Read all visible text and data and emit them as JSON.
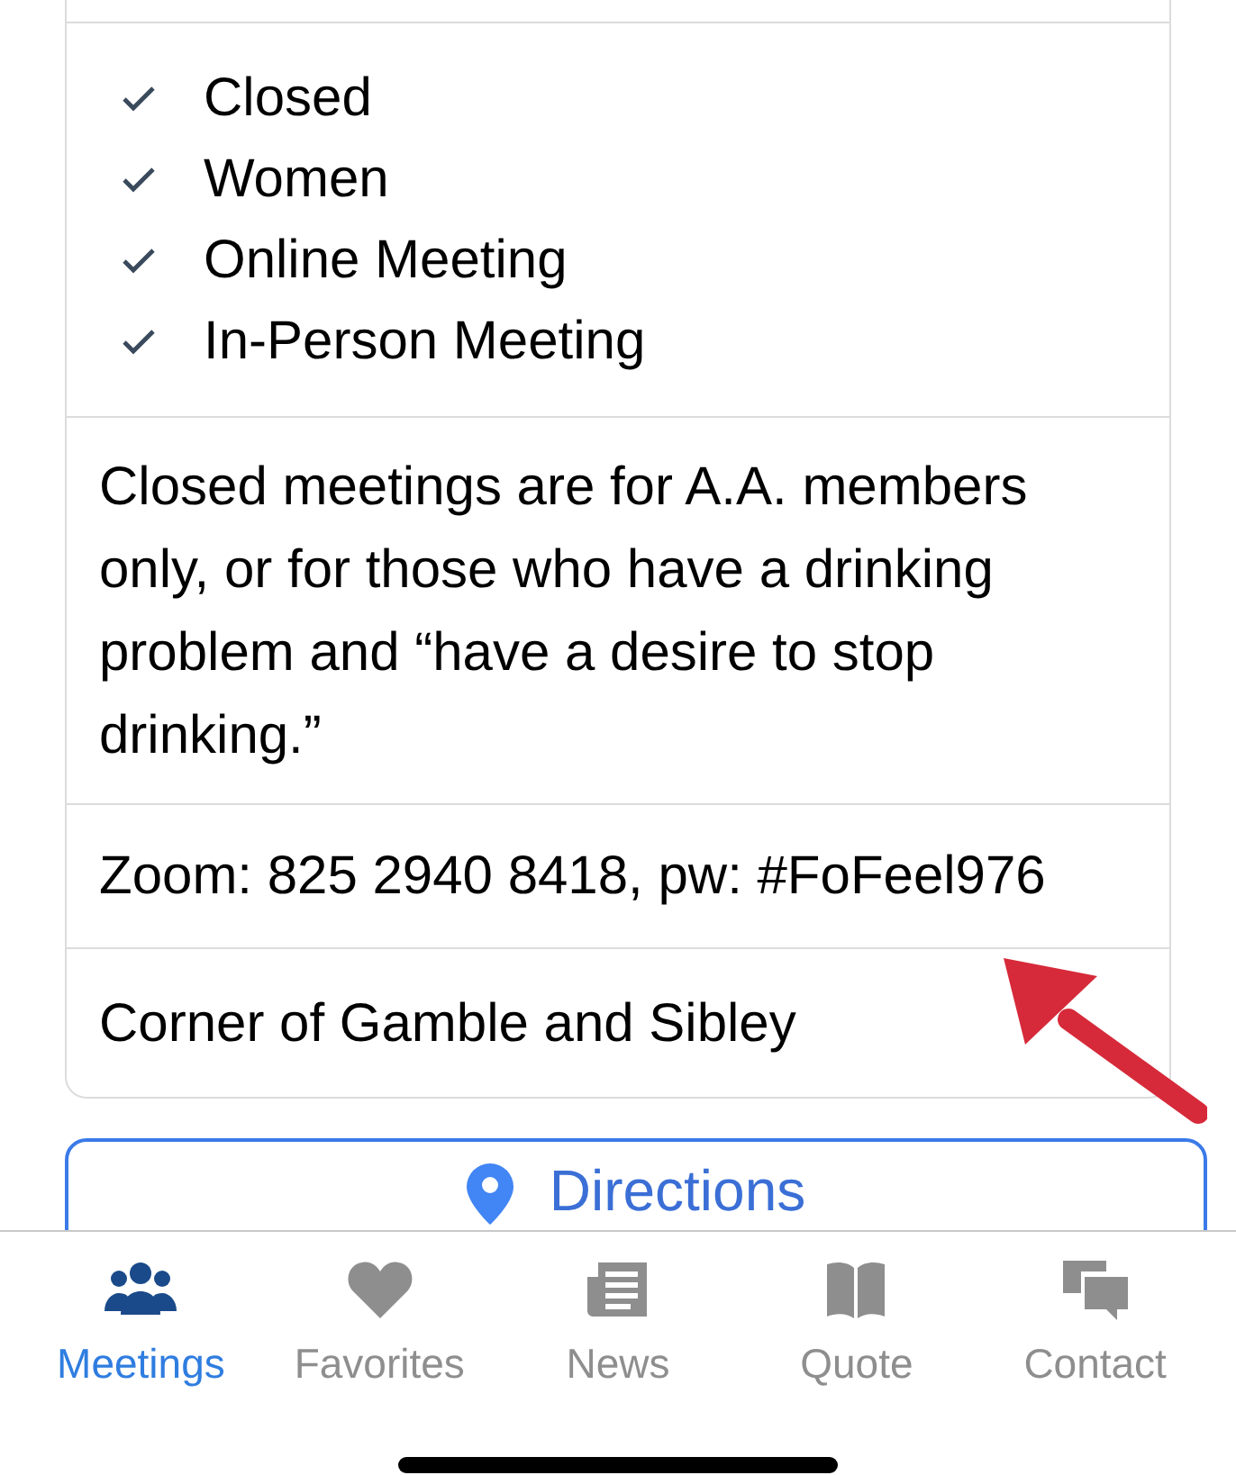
{
  "meeting_types": [
    {
      "label": "Closed",
      "checked": true
    },
    {
      "label": "Women",
      "checked": true
    },
    {
      "label": "Online Meeting",
      "checked": true
    },
    {
      "label": "In-Person Meeting",
      "checked": true
    }
  ],
  "description": "Closed meetings are for A.A. members only, or for those who have a drinking problem and “have a desire to stop drinking.”",
  "online_note": "Zoom: 825 2940 8418, pw: #FoFeel976",
  "location_note": "Corner of Gamble and Sibley",
  "directions_button": "Directions",
  "tab_bar": [
    {
      "label": "Meetings",
      "kind": "people",
      "selected": true
    },
    {
      "label": "Favorites",
      "kind": "heart",
      "selected": false
    },
    {
      "label": "News",
      "kind": "news",
      "selected": false
    },
    {
      "label": "Quote",
      "kind": "book",
      "selected": false
    },
    {
      "label": "Contact",
      "kind": "chat",
      "selected": false
    }
  ]
}
